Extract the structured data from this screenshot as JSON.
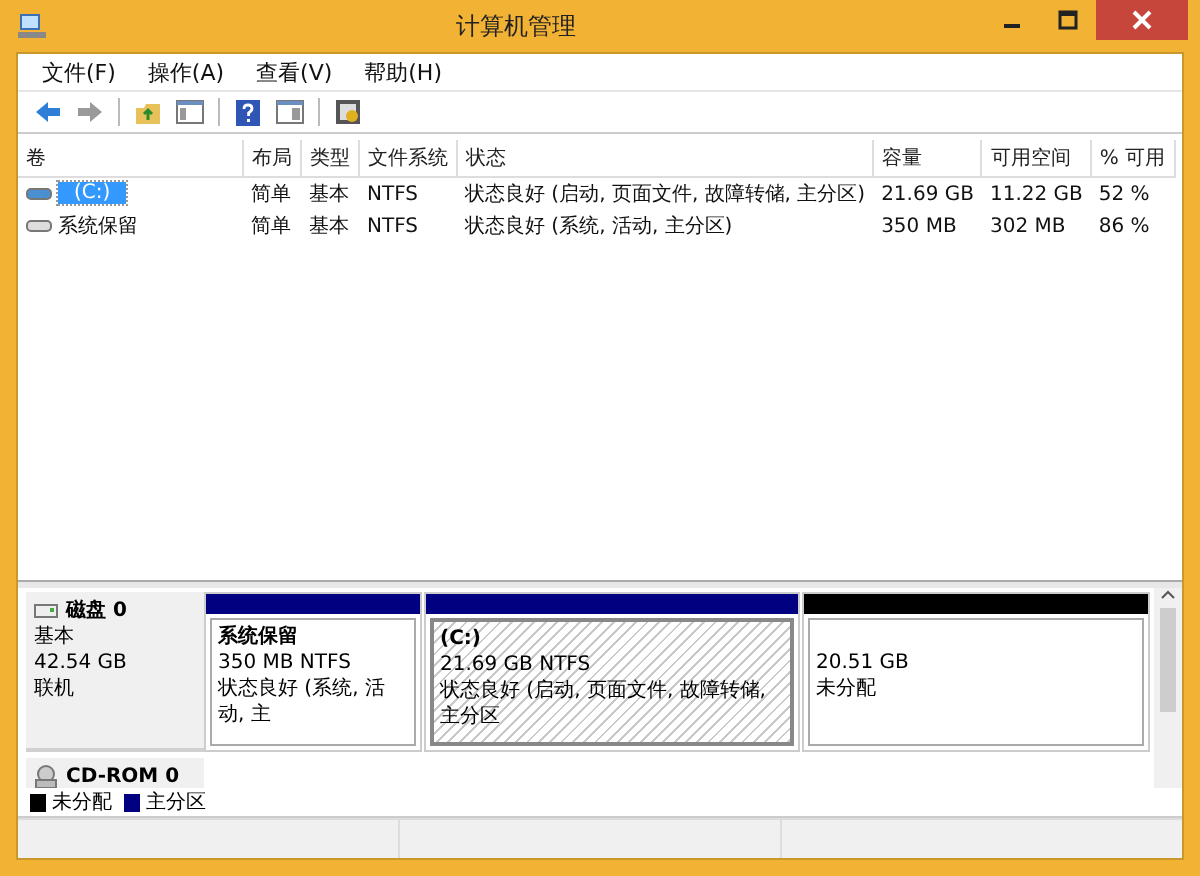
{
  "window": {
    "title": "计算机管理"
  },
  "menu": [
    "文件(F)",
    "操作(A)",
    "查看(V)",
    "帮助(H)"
  ],
  "volume_table": {
    "columns": [
      "卷",
      "布局",
      "类型",
      "文件系统",
      "状态",
      "容量",
      "可用空间",
      "% 可用"
    ],
    "rows": [
      {
        "selected": true,
        "cells": [
          "(C:)",
          "简单",
          "基本",
          "NTFS",
          "状态良好 (启动, 页面文件, 故障转储, 主分区)",
          "21.69 GB",
          "11.22 GB",
          "52 %"
        ]
      },
      {
        "selected": false,
        "cells": [
          "系统保留",
          "简单",
          "基本",
          "NTFS",
          "状态良好 (系统, 活动, 主分区)",
          "350 MB",
          "302 MB",
          "86 %"
        ]
      }
    ]
  },
  "disks": [
    {
      "kind": "disk",
      "name": "磁盘 0",
      "type": "基本",
      "size": "42.54 GB",
      "status": "联机",
      "partitions": [
        {
          "name": "系统保留",
          "size": "350 MB NTFS",
          "status": "状态良好 (系统, 活动, 主",
          "color": "#000080",
          "selected": false
        },
        {
          "name": "(C:)",
          "size": "21.69 GB NTFS",
          "status": "状态良好 (启动, 页面文件, 故障转储, 主分区",
          "color": "#000080",
          "selected": true
        },
        {
          "size": "20.51 GB",
          "status": "未分配",
          "color": "#000000",
          "selected": false
        }
      ]
    },
    {
      "kind": "cdrom",
      "name": "CD-ROM 0"
    }
  ],
  "legend": [
    {
      "label": "未分配",
      "color": "#000000"
    },
    {
      "label": "主分区",
      "color": "#000080"
    }
  ]
}
